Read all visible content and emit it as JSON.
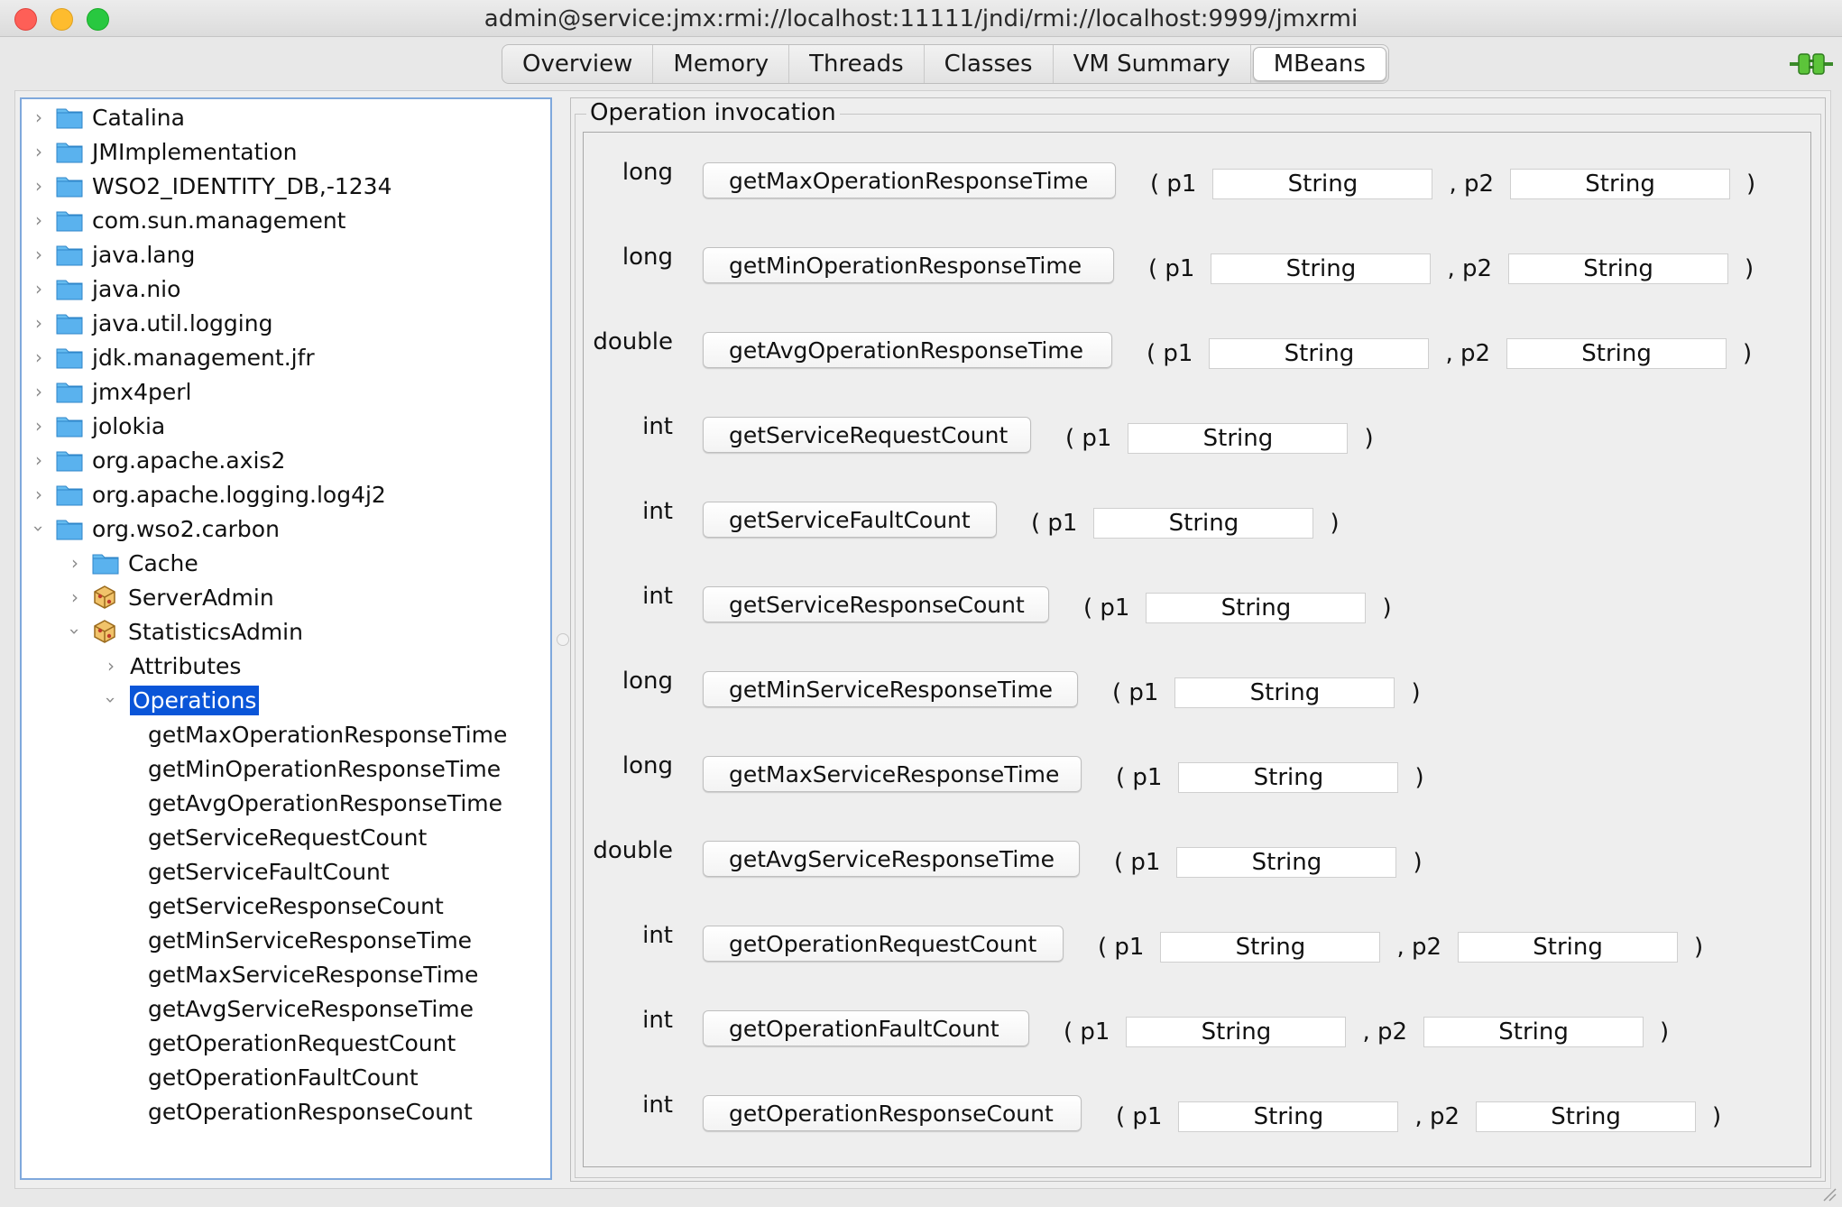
{
  "window": {
    "title": "admin@service:jmx:rmi://localhost:11111/jndi/rmi://localhost:9999/jmxrmi"
  },
  "tabs": [
    "Overview",
    "Memory",
    "Threads",
    "Classes",
    "VM Summary",
    "MBeans"
  ],
  "active_tab": "MBeans",
  "tree": {
    "domains": [
      "Catalina",
      "JMImplementation",
      "WSO2_IDENTITY_DB,-1234",
      "com.sun.management",
      "java.lang",
      "java.nio",
      "java.util.logging",
      "jdk.management.jfr",
      "jmx4perl",
      "jolokia",
      "org.apache.axis2",
      "org.apache.logging.log4j2"
    ],
    "expanded_domain": "org.wso2.carbon",
    "children": [
      "Cache",
      "ServerAdmin",
      "StatisticsAdmin"
    ],
    "statistics_children": [
      "Attributes",
      "Operations"
    ],
    "selected": "Operations",
    "operations": [
      "getMaxOperationResponseTime",
      "getMinOperationResponseTime",
      "getAvgOperationResponseTime",
      "getServiceRequestCount",
      "getServiceFaultCount",
      "getServiceResponseCount",
      "getMinServiceResponseTime",
      "getMaxServiceResponseTime",
      "getAvgServiceResponseTime",
      "getOperationRequestCount",
      "getOperationFaultCount",
      "getOperationResponseCount"
    ]
  },
  "invocation": {
    "legend": "Operation invocation",
    "param_open": "( p1",
    "param_sep": ", p2",
    "param_close": ")",
    "operations": [
      {
        "ret": "long",
        "name": "getMaxOperationResponseTime",
        "params": [
          "String",
          "String"
        ]
      },
      {
        "ret": "long",
        "name": "getMinOperationResponseTime",
        "params": [
          "String",
          "String"
        ]
      },
      {
        "ret": "double",
        "name": "getAvgOperationResponseTime",
        "params": [
          "String",
          "String"
        ]
      },
      {
        "ret": "int",
        "name": "getServiceRequestCount",
        "params": [
          "String"
        ]
      },
      {
        "ret": "int",
        "name": "getServiceFaultCount",
        "params": [
          "String"
        ]
      },
      {
        "ret": "int",
        "name": "getServiceResponseCount",
        "params": [
          "String"
        ]
      },
      {
        "ret": "long",
        "name": "getMinServiceResponseTime",
        "params": [
          "String"
        ]
      },
      {
        "ret": "long",
        "name": "getMaxServiceResponseTime",
        "params": [
          "String"
        ]
      },
      {
        "ret": "double",
        "name": "getAvgServiceResponseTime",
        "params": [
          "String"
        ]
      },
      {
        "ret": "int",
        "name": "getOperationRequestCount",
        "params": [
          "String",
          "String"
        ]
      },
      {
        "ret": "int",
        "name": "getOperationFaultCount",
        "params": [
          "String",
          "String"
        ]
      },
      {
        "ret": "int",
        "name": "getOperationResponseCount",
        "params": [
          "String",
          "String"
        ]
      }
    ]
  },
  "icons": {
    "folder": "folder-icon",
    "mbean": "mbean-icon",
    "connection": "connection-plug-icon"
  }
}
